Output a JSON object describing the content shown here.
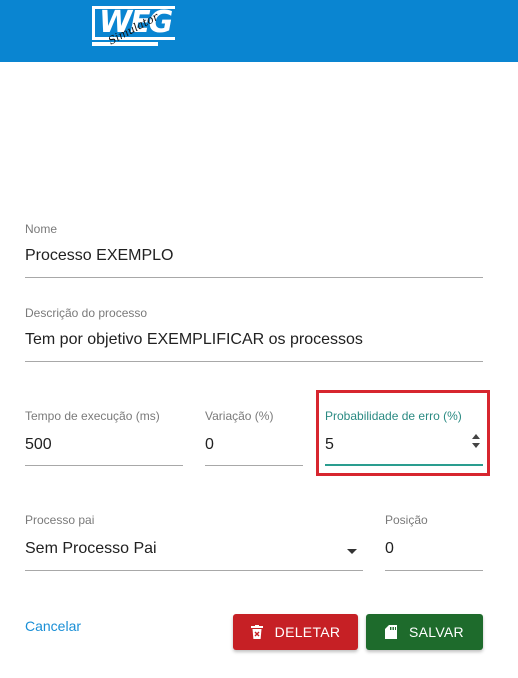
{
  "header": {
    "logo_text": "WEG",
    "logo_script": "Simulator",
    "color": "#0a85d1"
  },
  "form": {
    "nome": {
      "label": "Nome",
      "value": "Processo EXEMPLO"
    },
    "descricao": {
      "label": "Descrição do processo",
      "value": "Tem por objetivo EXEMPLIFICAR os processos"
    },
    "tempo": {
      "label": "Tempo de execução (ms)",
      "value": "500"
    },
    "variacao": {
      "label": "Variação (%)",
      "value": "0"
    },
    "probabilidade": {
      "label": "Probabilidade de erro (%)",
      "value": "5",
      "focused": true
    },
    "processo_pai": {
      "label": "Processo pai",
      "value": "Sem Processo Pai"
    },
    "posicao": {
      "label": "Posição",
      "value": "0"
    }
  },
  "actions": {
    "cancel_label": "Cancelar",
    "delete_label": "DELETAR",
    "save_label": "SALVAR",
    "delete_icon": "trash-icon",
    "save_icon": "save-icon",
    "delete_color": "#c62025",
    "save_color": "#1e6b2c",
    "link_color": "#1a8fd6"
  },
  "annotation": {
    "highlight_color": "#d7262f"
  }
}
